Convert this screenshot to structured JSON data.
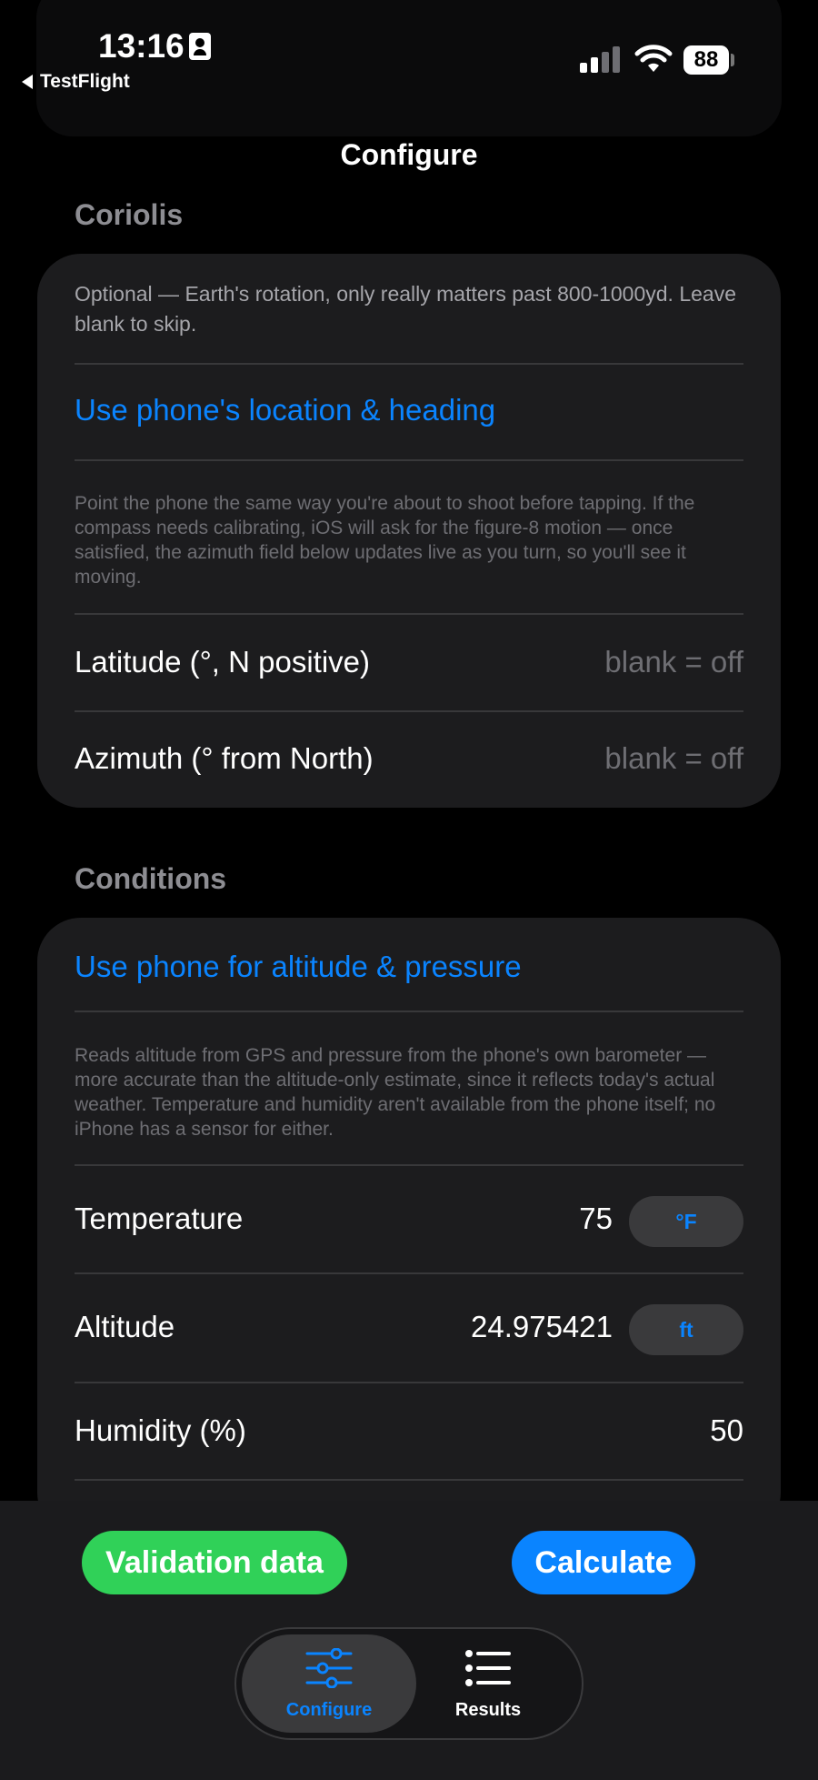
{
  "status_bar": {
    "time": "13:16",
    "back_app": "TestFlight",
    "battery": "88",
    "icons": [
      "contact-card-icon",
      "cellular-signal-icon",
      "wifi-icon",
      "battery-icon"
    ]
  },
  "nav": {
    "title": "Configure"
  },
  "coriolis": {
    "header": "Coriolis",
    "description": "Optional — Earth's rotation, only really matters past 800-1000yd. Leave blank to skip.",
    "location_button": "Use phone's location & heading",
    "footnote": "Point the phone the same way you're about to shoot before tapping. If the compass needs calibrating, iOS will ask for the figure-8 motion — once satisfied, the azimuth field below updates live as you turn, so you'll see it moving.",
    "latitude": {
      "label": "Latitude (°, N positive)",
      "placeholder": "blank = off",
      "value": ""
    },
    "azimuth": {
      "label": "Azimuth (° from North)",
      "placeholder": "blank = off",
      "value": ""
    }
  },
  "conditions": {
    "header": "Conditions",
    "phone_button": "Use phone for altitude & pressure",
    "footnote": "Reads altitude from GPS and pressure from the phone's own barometer — more accurate than the altitude-only estimate, since it reflects today's actual weather. Temperature and humidity aren't available from the phone itself; no iPhone has a sensor for either.",
    "temperature": {
      "label": "Temperature",
      "value": "75",
      "unit": "°F"
    },
    "altitude": {
      "label": "Altitude",
      "value": "24.975421",
      "unit": "ft"
    },
    "humidity": {
      "label": "Humidity (%)",
      "value": "50"
    }
  },
  "actions": {
    "validation": "Validation data",
    "calculate": "Calculate"
  },
  "tabs": [
    {
      "label": "Configure",
      "icon": "sliders-icon",
      "selected": true
    },
    {
      "label": "Results",
      "icon": "list-icon",
      "selected": false
    }
  ],
  "colors": {
    "accent": "#0a84ff",
    "green": "#30d158",
    "card": "#1c1c1e",
    "background": "#000000"
  }
}
